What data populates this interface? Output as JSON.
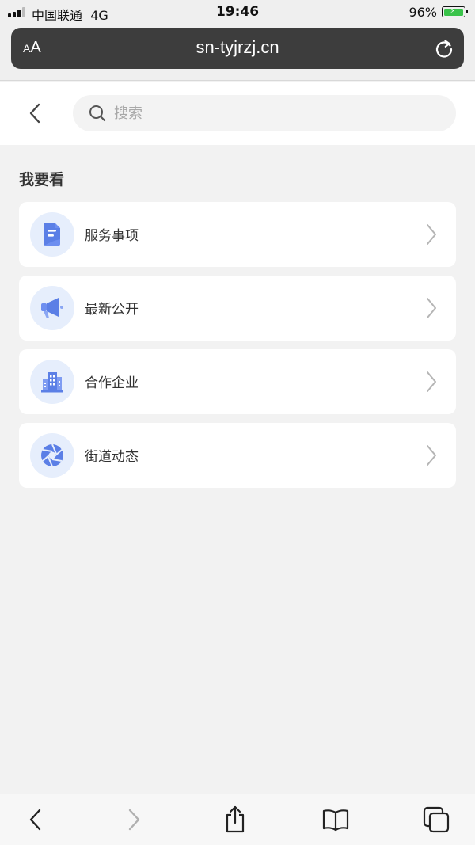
{
  "status_bar": {
    "carrier": "中国联通",
    "network": "4G",
    "time": "19:46",
    "battery": "96%",
    "battery_level": 0.96,
    "charging": true
  },
  "browser": {
    "text_size_label_small": "A",
    "text_size_label_large": "A",
    "url": "sn-tyjrzj.cn"
  },
  "header": {
    "search_placeholder": "搜索"
  },
  "section": {
    "title": "我要看",
    "items": [
      {
        "label": "服务事项",
        "icon": "document-icon"
      },
      {
        "label": "最新公开",
        "icon": "megaphone-icon"
      },
      {
        "label": "合作企业",
        "icon": "building-icon"
      },
      {
        "label": "街道动态",
        "icon": "aperture-icon"
      }
    ]
  },
  "colors": {
    "accent": "#5b7fe6",
    "icon_bg": "#e6eefc",
    "page_bg": "#f2f2f2",
    "url_bar_bg": "#3d3d3d"
  }
}
